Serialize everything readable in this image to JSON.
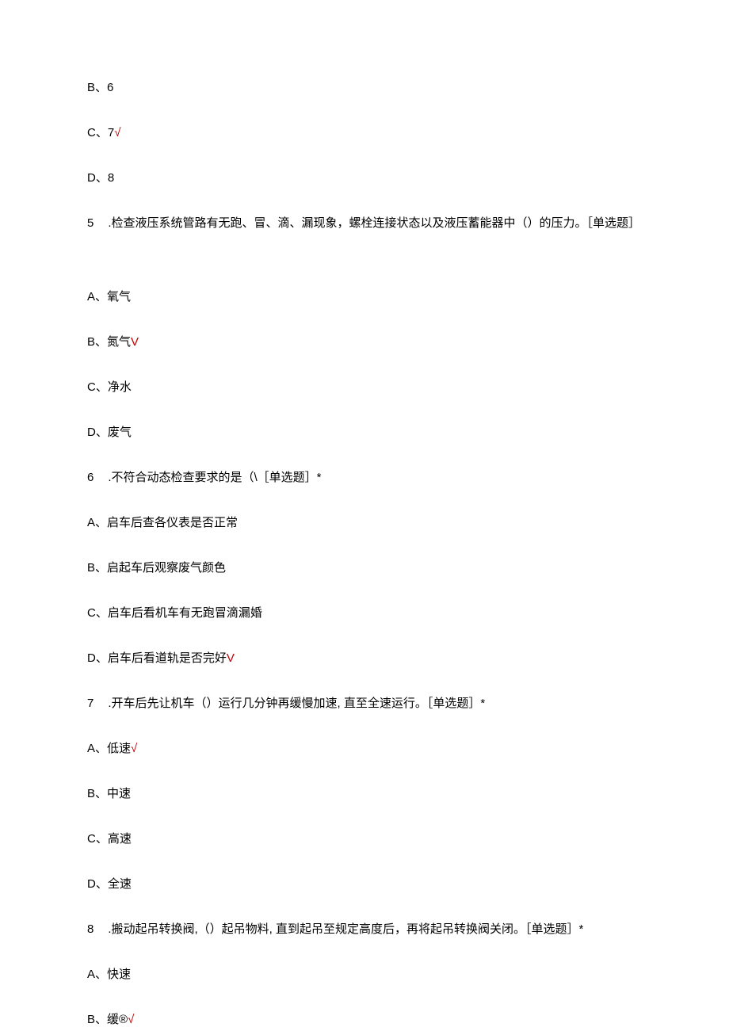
{
  "lines": [
    {
      "type": "option",
      "text": "B、6",
      "correct": false
    },
    {
      "type": "option",
      "text": "C、7",
      "correct": true,
      "mark": "√"
    },
    {
      "type": "option",
      "text": "D、8",
      "correct": false
    },
    {
      "type": "question",
      "num": "5",
      "text": ".检查液压系统管路有无跑、冒、滴、漏现象，螺栓连接状态以及液压蓄能器中（）的压力。［单选题］"
    },
    {
      "type": "spacer"
    },
    {
      "type": "option",
      "text": "A、氧气",
      "correct": false
    },
    {
      "type": "option",
      "text": "B、氮气",
      "correct": true,
      "mark": "V"
    },
    {
      "type": "option",
      "text": "C、净水",
      "correct": false
    },
    {
      "type": "option",
      "text": "D、废气",
      "correct": false
    },
    {
      "type": "question",
      "num": "6",
      "text": ".不符合动态检查要求的是（\\［单选题］*"
    },
    {
      "type": "option",
      "text": "A、启车后查各仪表是否正常",
      "correct": false
    },
    {
      "type": "option",
      "text": "B、启起车后观察废气颜色",
      "correct": false
    },
    {
      "type": "option",
      "text": "C、启车后看机车有无跑冒滴漏婚",
      "correct": false
    },
    {
      "type": "option",
      "text": "D、启车后看道轨是否完好",
      "correct": true,
      "mark": "V"
    },
    {
      "type": "question",
      "num": "7",
      "text": ".开车后先让机车（）运行几分钟再缓慢加速, 直至全速运行。［单选题］*"
    },
    {
      "type": "option",
      "text": "A、低速",
      "correct": true,
      "mark": "√"
    },
    {
      "type": "option",
      "text": "B、中速",
      "correct": false
    },
    {
      "type": "option",
      "text": "C、高速",
      "correct": false
    },
    {
      "type": "option",
      "text": "D、全速",
      "correct": false
    },
    {
      "type": "question",
      "num": "8",
      "text": ".搬动起吊转换阀,（）起吊物料, 直到起吊至规定高度后，再将起吊转换阀关闭。［单选题］*"
    },
    {
      "type": "option",
      "text": "A、快速",
      "correct": false
    },
    {
      "type": "option",
      "text": "B、缓®",
      "correct": true,
      "mark": "√"
    }
  ]
}
